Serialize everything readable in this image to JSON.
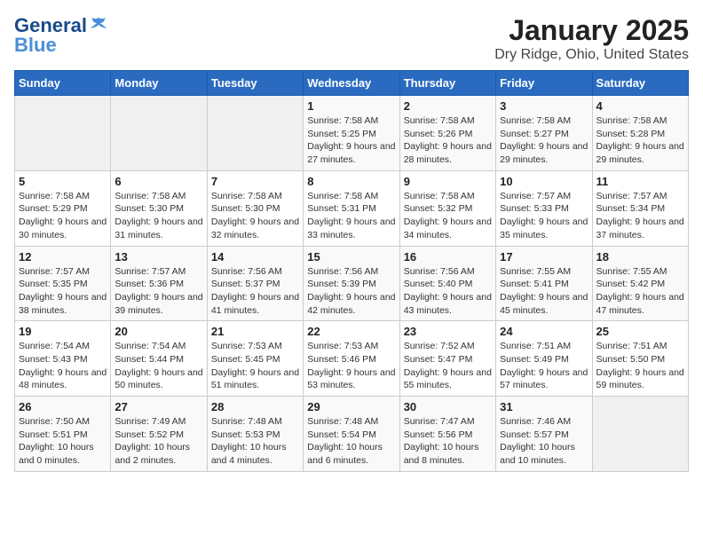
{
  "header": {
    "logo_line1": "General",
    "logo_line2": "Blue",
    "title": "January 2025",
    "subtitle": "Dry Ridge, Ohio, United States"
  },
  "days_of_week": [
    "Sunday",
    "Monday",
    "Tuesday",
    "Wednesday",
    "Thursday",
    "Friday",
    "Saturday"
  ],
  "weeks": [
    [
      {
        "num": "",
        "info": "",
        "empty": true
      },
      {
        "num": "",
        "info": "",
        "empty": true
      },
      {
        "num": "",
        "info": "",
        "empty": true
      },
      {
        "num": "1",
        "info": "Sunrise: 7:58 AM\nSunset: 5:25 PM\nDaylight: 9 hours and 27 minutes."
      },
      {
        "num": "2",
        "info": "Sunrise: 7:58 AM\nSunset: 5:26 PM\nDaylight: 9 hours and 28 minutes."
      },
      {
        "num": "3",
        "info": "Sunrise: 7:58 AM\nSunset: 5:27 PM\nDaylight: 9 hours and 29 minutes."
      },
      {
        "num": "4",
        "info": "Sunrise: 7:58 AM\nSunset: 5:28 PM\nDaylight: 9 hours and 29 minutes."
      }
    ],
    [
      {
        "num": "5",
        "info": "Sunrise: 7:58 AM\nSunset: 5:29 PM\nDaylight: 9 hours and 30 minutes."
      },
      {
        "num": "6",
        "info": "Sunrise: 7:58 AM\nSunset: 5:30 PM\nDaylight: 9 hours and 31 minutes."
      },
      {
        "num": "7",
        "info": "Sunrise: 7:58 AM\nSunset: 5:30 PM\nDaylight: 9 hours and 32 minutes."
      },
      {
        "num": "8",
        "info": "Sunrise: 7:58 AM\nSunset: 5:31 PM\nDaylight: 9 hours and 33 minutes."
      },
      {
        "num": "9",
        "info": "Sunrise: 7:58 AM\nSunset: 5:32 PM\nDaylight: 9 hours and 34 minutes."
      },
      {
        "num": "10",
        "info": "Sunrise: 7:57 AM\nSunset: 5:33 PM\nDaylight: 9 hours and 35 minutes."
      },
      {
        "num": "11",
        "info": "Sunrise: 7:57 AM\nSunset: 5:34 PM\nDaylight: 9 hours and 37 minutes."
      }
    ],
    [
      {
        "num": "12",
        "info": "Sunrise: 7:57 AM\nSunset: 5:35 PM\nDaylight: 9 hours and 38 minutes."
      },
      {
        "num": "13",
        "info": "Sunrise: 7:57 AM\nSunset: 5:36 PM\nDaylight: 9 hours and 39 minutes."
      },
      {
        "num": "14",
        "info": "Sunrise: 7:56 AM\nSunset: 5:37 PM\nDaylight: 9 hours and 41 minutes."
      },
      {
        "num": "15",
        "info": "Sunrise: 7:56 AM\nSunset: 5:39 PM\nDaylight: 9 hours and 42 minutes."
      },
      {
        "num": "16",
        "info": "Sunrise: 7:56 AM\nSunset: 5:40 PM\nDaylight: 9 hours and 43 minutes."
      },
      {
        "num": "17",
        "info": "Sunrise: 7:55 AM\nSunset: 5:41 PM\nDaylight: 9 hours and 45 minutes."
      },
      {
        "num": "18",
        "info": "Sunrise: 7:55 AM\nSunset: 5:42 PM\nDaylight: 9 hours and 47 minutes."
      }
    ],
    [
      {
        "num": "19",
        "info": "Sunrise: 7:54 AM\nSunset: 5:43 PM\nDaylight: 9 hours and 48 minutes."
      },
      {
        "num": "20",
        "info": "Sunrise: 7:54 AM\nSunset: 5:44 PM\nDaylight: 9 hours and 50 minutes."
      },
      {
        "num": "21",
        "info": "Sunrise: 7:53 AM\nSunset: 5:45 PM\nDaylight: 9 hours and 51 minutes."
      },
      {
        "num": "22",
        "info": "Sunrise: 7:53 AM\nSunset: 5:46 PM\nDaylight: 9 hours and 53 minutes."
      },
      {
        "num": "23",
        "info": "Sunrise: 7:52 AM\nSunset: 5:47 PM\nDaylight: 9 hours and 55 minutes."
      },
      {
        "num": "24",
        "info": "Sunrise: 7:51 AM\nSunset: 5:49 PM\nDaylight: 9 hours and 57 minutes."
      },
      {
        "num": "25",
        "info": "Sunrise: 7:51 AM\nSunset: 5:50 PM\nDaylight: 9 hours and 59 minutes."
      }
    ],
    [
      {
        "num": "26",
        "info": "Sunrise: 7:50 AM\nSunset: 5:51 PM\nDaylight: 10 hours and 0 minutes."
      },
      {
        "num": "27",
        "info": "Sunrise: 7:49 AM\nSunset: 5:52 PM\nDaylight: 10 hours and 2 minutes."
      },
      {
        "num": "28",
        "info": "Sunrise: 7:48 AM\nSunset: 5:53 PM\nDaylight: 10 hours and 4 minutes."
      },
      {
        "num": "29",
        "info": "Sunrise: 7:48 AM\nSunset: 5:54 PM\nDaylight: 10 hours and 6 minutes."
      },
      {
        "num": "30",
        "info": "Sunrise: 7:47 AM\nSunset: 5:56 PM\nDaylight: 10 hours and 8 minutes."
      },
      {
        "num": "31",
        "info": "Sunrise: 7:46 AM\nSunset: 5:57 PM\nDaylight: 10 hours and 10 minutes."
      },
      {
        "num": "",
        "info": "",
        "empty": true
      }
    ]
  ]
}
